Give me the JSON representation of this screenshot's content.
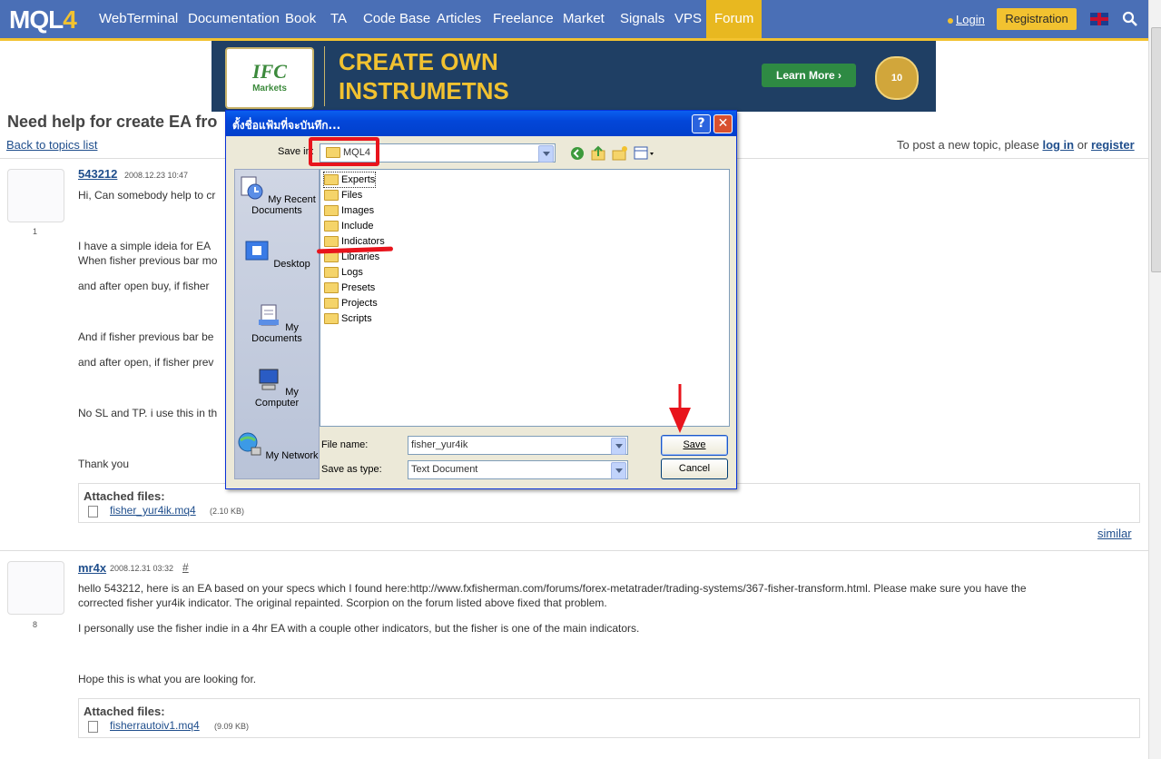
{
  "nav": {
    "logo_main": "MQL",
    "logo_four": "4",
    "items": [
      "WebTerminal",
      "Documentation",
      "Book",
      "TA",
      "Code Base",
      "Articles",
      "Freelance",
      "Market",
      "Signals",
      "VPS",
      "Forum"
    ],
    "login": "Login",
    "registration": "Registration"
  },
  "banner": {
    "logo_text": "IFC",
    "logo_sub": "Markets",
    "line1": "CREATE OWN",
    "line2": "INSTRUMETNS",
    "cta": "Learn More",
    "medal": "10"
  },
  "page": {
    "title": "Need help for create EA fro",
    "back": "Back to topics list",
    "new_topic_text": "To post a new topic, please",
    "login_link": "log in",
    "or": "or",
    "register_link": "register",
    "similar": "similar"
  },
  "post1": {
    "author": "543212",
    "time": "2008.12.23 10:47",
    "rank": "1",
    "lines": [
      "Hi, Can somebody help to cr",
      "I have a simple ideia for EA",
      "When fisher previous bar mo",
      "and after open buy, if fisher",
      "And if fisher previous bar be",
      "and after open, if fisher prev",
      "No SL and TP. i use this in th",
      "Thank you"
    ],
    "attached_title": "Attached files:",
    "file": "fisher_yur4ik.mq4",
    "size": "(2.10 KB)"
  },
  "post2": {
    "author": "mr4x",
    "time": "2008.12.31 03:32",
    "hash": "#",
    "rank": "8",
    "lines": [
      "hello 543212, here is an EA based on your specs which I found here:http://www.fxfisherman.com/forums/forex-metatrader/trading-systems/367-fisher-transform.html. Please make sure you have the",
      "corrected fisher yur4ik indicator. The original repainted. Scorpion on the forum listed above fixed that problem.",
      "I personally use the fisher indie in a 4hr EA with a couple other indicators, but the fisher is one of the main indicators.",
      "Hope this is what you are looking for."
    ],
    "attached_title": "Attached files:",
    "file": "fisherrautoiv1.mq4",
    "size": "(9.09 KB)"
  },
  "dialog": {
    "title": "ตั้งชื่อแฟ้มที่จะบันทึก...",
    "help": "?",
    "close": "✕",
    "save_in_label": "Save in:",
    "save_in_value": "MQL4",
    "places": [
      "My Recent Documents",
      "Desktop",
      "My Documents",
      "My Computer",
      "My Network"
    ],
    "folders": [
      "Experts",
      "Files",
      "Images",
      "Include",
      "Indicators",
      "Libraries",
      "Logs",
      "Presets",
      "Projects",
      "Scripts"
    ],
    "file_name_label": "File name:",
    "file_name_value": "fisher_yur4ik",
    "save_type_label": "Save as type:",
    "save_type_value": "Text Document",
    "save_btn": "Save",
    "cancel_btn": "Cancel"
  },
  "colors": {
    "nav_bg": "#4a6fb6",
    "accent": "#f2c230",
    "highlight": "#e8141c"
  }
}
